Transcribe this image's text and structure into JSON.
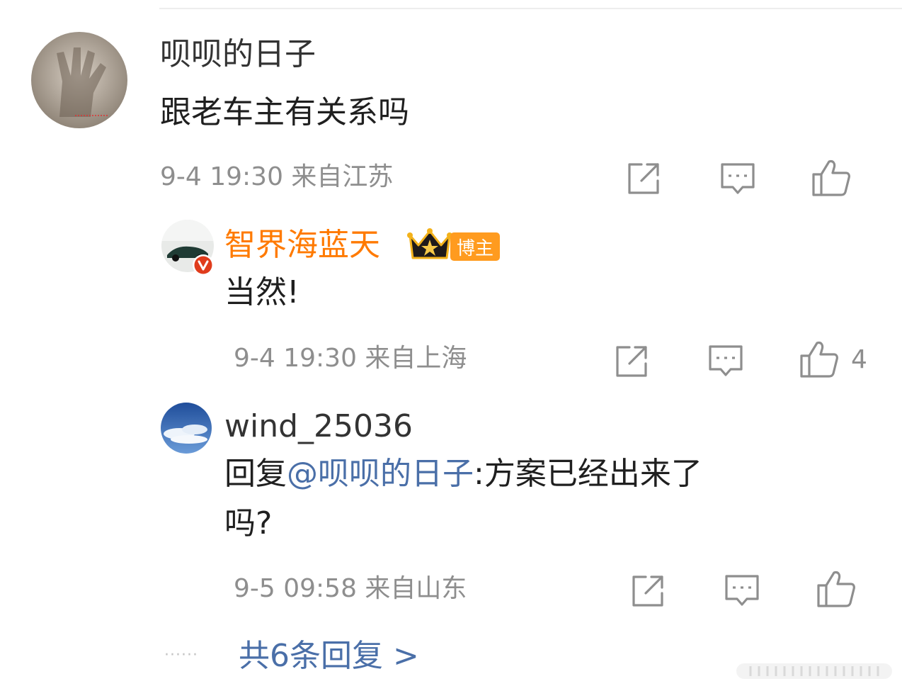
{
  "comments": [
    {
      "username": "呗呗的日子",
      "text": "跟老车主有关系吗",
      "meta": "9-4 19:30 来自江苏",
      "avatar_icon": "hand-photo-avatar",
      "like_count": ""
    },
    {
      "username": "智界海蓝天",
      "badge_label": "博主",
      "verified_icon": "verified-v-icon",
      "text": "当然!",
      "meta": "9-4 19:30 来自上海",
      "avatar_icon": "car-photo-avatar",
      "like_count": "4"
    },
    {
      "username": "wind_25036",
      "reply_prefix": "回复",
      "mention": "@呗呗的日子",
      "reply_text_1": ":方案已经出来了",
      "reply_text_2": "吗?",
      "meta": "9-5 09:58 来自山东",
      "avatar_icon": "sky-photo-avatar",
      "like_count": ""
    }
  ],
  "more_replies": {
    "dots": "······",
    "label": "共6条回复 >"
  },
  "colors": {
    "username_orange": "#ff7a00",
    "link_blue": "#4a6fa8",
    "meta_gray": "#8e8e8e",
    "icon_gray": "#8e8e8e",
    "badge_orange": "#ff9b1f"
  }
}
